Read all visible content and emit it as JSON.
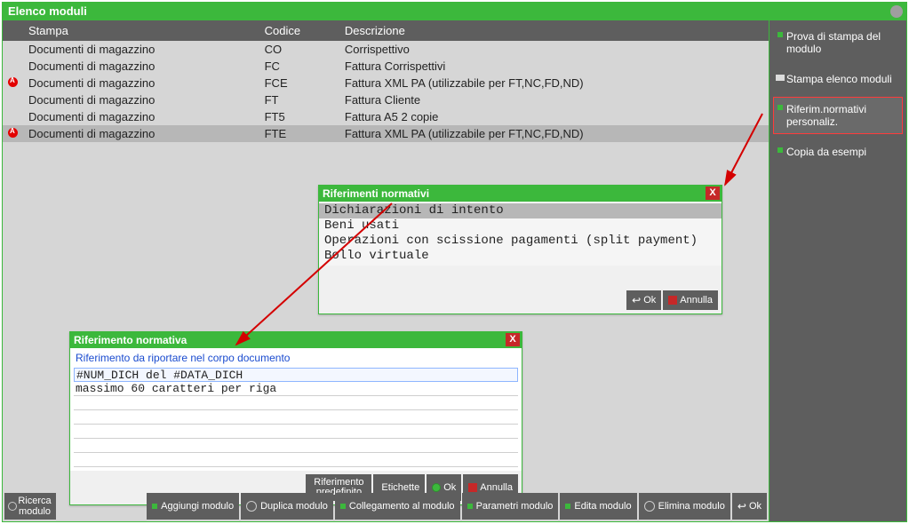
{
  "window": {
    "title": "Elenco moduli"
  },
  "table": {
    "headers": {
      "stampa": "Stampa",
      "codice": "Codice",
      "descrizione": "Descrizione"
    },
    "rows": [
      {
        "flag": false,
        "stampa": "Documenti di magazzino",
        "codice": "CO",
        "descr": "Corrispettivo",
        "selected": false
      },
      {
        "flag": false,
        "stampa": "Documenti di magazzino",
        "codice": "FC",
        "descr": "Fattura Corrispettivi",
        "selected": false
      },
      {
        "flag": true,
        "stampa": "Documenti di magazzino",
        "codice": "FCE",
        "descr": "Fattura XML PA (utilizzabile per FT,NC,FD,ND)",
        "selected": false
      },
      {
        "flag": false,
        "stampa": "Documenti di magazzino",
        "codice": "FT",
        "descr": "Fattura Cliente",
        "selected": false
      },
      {
        "flag": false,
        "stampa": "Documenti di magazzino",
        "codice": "FT5",
        "descr": "Fattura A5 2 copie",
        "selected": false
      },
      {
        "flag": true,
        "stampa": "Documenti di magazzino",
        "codice": "FTE",
        "descr": "Fattura XML PA (utilizzabile per FT,NC,FD,ND)",
        "selected": true
      }
    ]
  },
  "sidebar": {
    "items": [
      {
        "label": "Prova di stampa del modulo"
      },
      {
        "label": "Stampa elenco moduli"
      },
      {
        "label": "Riferim.normativi personaliz."
      },
      {
        "label": "Copia da esempi"
      }
    ]
  },
  "bottom": {
    "ricerca": "Ricerca modulo",
    "aggiungi": "Aggiungi modulo",
    "duplica": "Duplica modulo",
    "collegamento": "Collegamento al modulo",
    "parametri": "Parametri modulo",
    "edita": "Edita modulo",
    "elimina": "Elimina modulo",
    "ok": "Ok"
  },
  "popup1": {
    "title": "Riferimenti normativi",
    "items": [
      "Dichiarazioni di intento",
      "Beni usati",
      "Operazioni con scissione pagamenti (split payment)",
      "Bollo virtuale"
    ],
    "ok": "Ok",
    "annulla": "Annulla"
  },
  "popup2": {
    "title": "Riferimento normativa",
    "subtitle": "Riferimento da riportare nel corpo documento",
    "line1": "#NUM_DICH del #DATA_DICH",
    "line2": "massimo 60 caratteri per riga",
    "rif_predef": "Riferimento predefinito",
    "etichette": "Etichette",
    "ok": "Ok",
    "annulla": "Annulla"
  }
}
